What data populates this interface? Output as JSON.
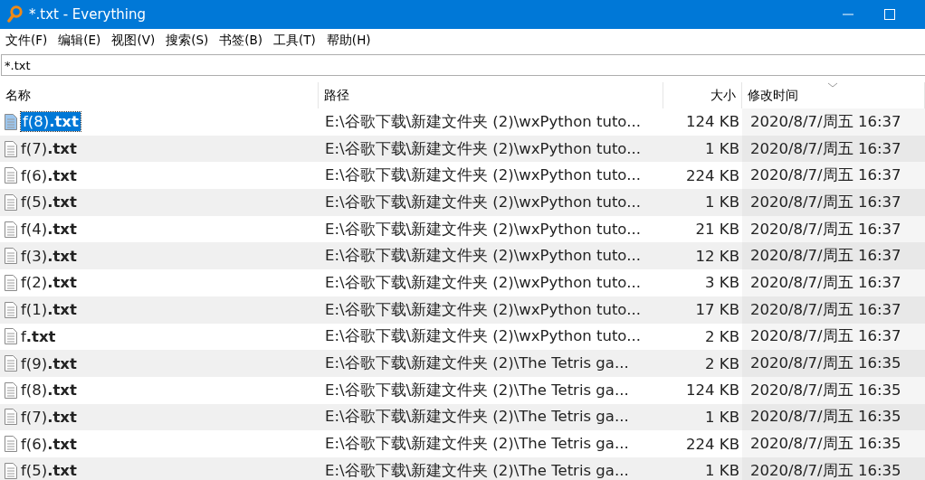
{
  "window": {
    "title": "*.txt - Everything"
  },
  "menu": [
    "文件(F)",
    "编辑(E)",
    "视图(V)",
    "搜索(S)",
    "书签(B)",
    "工具(T)",
    "帮助(H)"
  ],
  "search": {
    "value": "*.txt"
  },
  "columns": [
    {
      "label": "名称",
      "sorted": false
    },
    {
      "label": "路径",
      "sorted": false
    },
    {
      "label": "大小",
      "sorted": false
    },
    {
      "label": "修改时间",
      "sorted": true
    }
  ],
  "rows": [
    {
      "name": "f(8)**.txt**",
      "path": "E:\\谷歌下载\\新建文件夹 (2)\\wxPython tuto...",
      "size": "124 KB",
      "modified": "2020/8/7/周五 16:37",
      "selected": true
    },
    {
      "name": "f(7)**.txt**",
      "path": "E:\\谷歌下载\\新建文件夹 (2)\\wxPython tuto...",
      "size": "1 KB",
      "modified": "2020/8/7/周五 16:37",
      "selected": false
    },
    {
      "name": "f(6)**.txt**",
      "path": "E:\\谷歌下载\\新建文件夹 (2)\\wxPython tuto...",
      "size": "224 KB",
      "modified": "2020/8/7/周五 16:37",
      "selected": false
    },
    {
      "name": "f(5)**.txt**",
      "path": "E:\\谷歌下载\\新建文件夹 (2)\\wxPython tuto...",
      "size": "1 KB",
      "modified": "2020/8/7/周五 16:37",
      "selected": false
    },
    {
      "name": "f(4)**.txt**",
      "path": "E:\\谷歌下载\\新建文件夹 (2)\\wxPython tuto...",
      "size": "21 KB",
      "modified": "2020/8/7/周五 16:37",
      "selected": false
    },
    {
      "name": "f(3)**.txt**",
      "path": "E:\\谷歌下载\\新建文件夹 (2)\\wxPython tuto...",
      "size": "12 KB",
      "modified": "2020/8/7/周五 16:37",
      "selected": false
    },
    {
      "name": "f(2)**.txt**",
      "path": "E:\\谷歌下载\\新建文件夹 (2)\\wxPython tuto...",
      "size": "3 KB",
      "modified": "2020/8/7/周五 16:37",
      "selected": false
    },
    {
      "name": "f(1)**.txt**",
      "path": "E:\\谷歌下载\\新建文件夹 (2)\\wxPython tuto...",
      "size": "17 KB",
      "modified": "2020/8/7/周五 16:37",
      "selected": false
    },
    {
      "name": "f**.txt**",
      "path": "E:\\谷歌下载\\新建文件夹 (2)\\wxPython tuto...",
      "size": "2 KB",
      "modified": "2020/8/7/周五 16:37",
      "selected": false
    },
    {
      "name": "f(9)**.txt**",
      "path": "E:\\谷歌下载\\新建文件夹 (2)\\The Tetris ga...",
      "size": "2 KB",
      "modified": "2020/8/7/周五 16:35",
      "selected": false
    },
    {
      "name": "f(8)**.txt**",
      "path": "E:\\谷歌下载\\新建文件夹 (2)\\The Tetris ga...",
      "size": "124 KB",
      "modified": "2020/8/7/周五 16:35",
      "selected": false
    },
    {
      "name": "f(7)**.txt**",
      "path": "E:\\谷歌下载\\新建文件夹 (2)\\The Tetris ga...",
      "size": "1 KB",
      "modified": "2020/8/7/周五 16:35",
      "selected": false
    },
    {
      "name": "f(6)**.txt**",
      "path": "E:\\谷歌下载\\新建文件夹 (2)\\The Tetris ga...",
      "size": "224 KB",
      "modified": "2020/8/7/周五 16:35",
      "selected": false
    },
    {
      "name": "f(5)**.txt**",
      "path": "E:\\谷歌下载\\新建文件夹 (2)\\The Tetris ga...",
      "size": "1 KB",
      "modified": "2020/8/7/周五 16:35",
      "selected": false
    }
  ]
}
